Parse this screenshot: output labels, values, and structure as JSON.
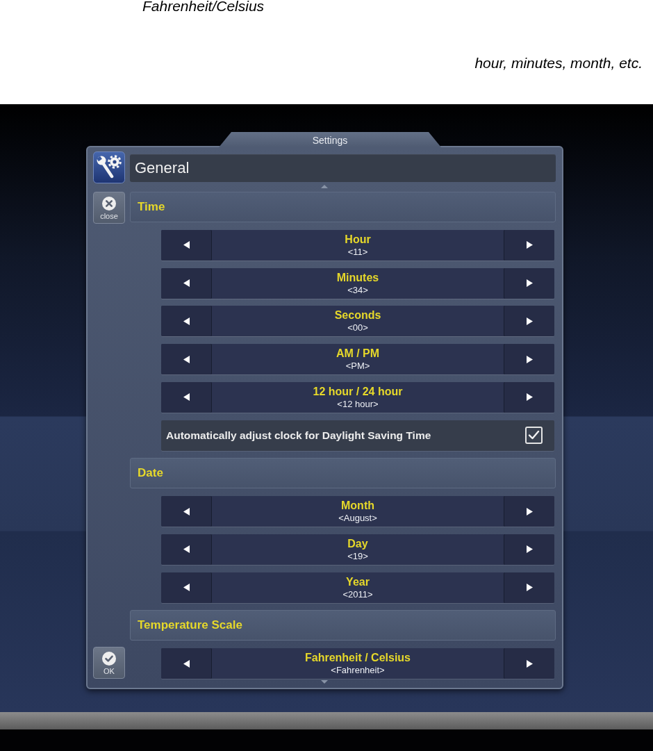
{
  "annotations": [
    "Fahrenheit/Celsius",
    "hour, minutes, month, etc."
  ],
  "dialog": {
    "title": "Settings",
    "header": "General",
    "close_button": "close",
    "ok_button": "OK",
    "sections": [
      {
        "title": "Time",
        "items": [
          {
            "kind": "spinner",
            "label": "Hour",
            "value": "<11>"
          },
          {
            "kind": "spinner",
            "label": "Minutes",
            "value": "<34>"
          },
          {
            "kind": "spinner",
            "label": "Seconds",
            "value": "<00>"
          },
          {
            "kind": "spinner",
            "label": "AM / PM",
            "value": "<PM>"
          },
          {
            "kind": "spinner",
            "label": "12 hour / 24 hour",
            "value": "<12 hour>"
          },
          {
            "kind": "checkbox",
            "label": "Automatically adjust clock for Daylight Saving Time",
            "checked": true
          }
        ]
      },
      {
        "title": "Date",
        "items": [
          {
            "kind": "spinner",
            "label": "Month",
            "value": "<August>"
          },
          {
            "kind": "spinner",
            "label": "Day",
            "value": "<19>"
          },
          {
            "kind": "spinner",
            "label": "Year",
            "value": "<2011>"
          }
        ]
      },
      {
        "title": "Temperature Scale",
        "items": [
          {
            "kind": "spinner",
            "label": "Fahrenheit / Celsius",
            "value": "<Fahrenheit>"
          }
        ]
      }
    ]
  }
}
